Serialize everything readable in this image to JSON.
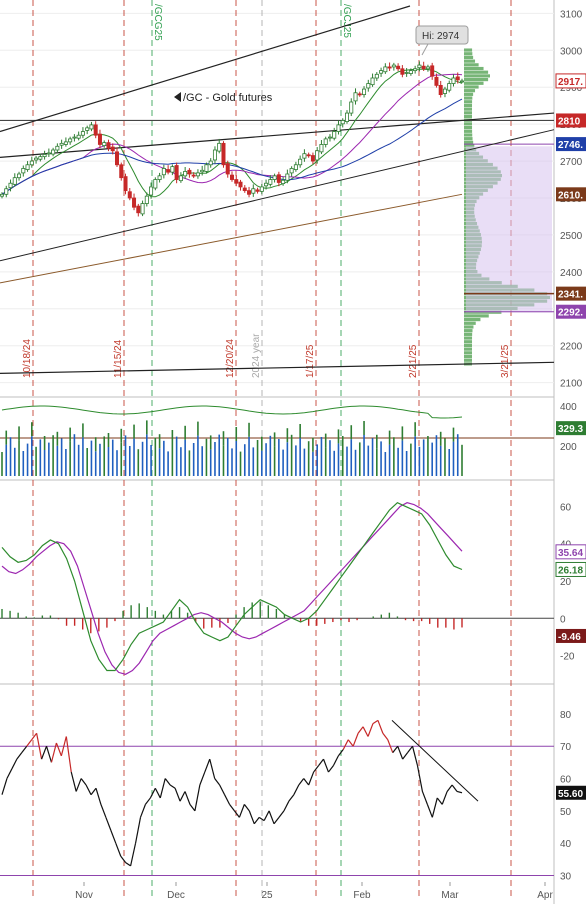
{
  "symbol": {
    "ticker": "/GC",
    "description": "Gold futures",
    "label": "/GC - Gold futures"
  },
  "colors": {
    "up": "#2e7d32",
    "down": "#c62828",
    "price_line": "#333333",
    "ma_green": "#2e8b2e",
    "ma_purple": "#9c27b0",
    "ma_blue": "#1f3fa8",
    "ma_brown": "#8b5a2b",
    "profile_green": "#5fa85f",
    "profile_purple": "#d7c3ee",
    "vline_red": "#c0392b",
    "vline_green": "#2e9e4e",
    "vline_gray": "#aaaaaa",
    "hline_brown": "#7b3a1a",
    "hline_purple": "#8e44ad"
  },
  "x_axis": {
    "labels": [
      "Nov",
      "Dec",
      "25",
      "Feb",
      "Mar",
      "Apr"
    ]
  },
  "chart_data": [
    {
      "type": "candlestick",
      "panel": "price",
      "ylim": [
        2080,
        3120
      ],
      "yticks": [
        2100,
        2200,
        2300,
        2400,
        2500,
        2600,
        2700,
        2800,
        2900,
        3000,
        3100
      ],
      "badges": [
        {
          "value": 2917.1,
          "label": "2917.",
          "color": "#c62828"
        },
        {
          "value": 2810,
          "label": "2810",
          "color": "#c62828"
        },
        {
          "value": 2746,
          "label": "2746.",
          "color": "#1f3fa8"
        },
        {
          "value": 2610,
          "label": "2610.",
          "color": "#7b3a1a"
        },
        {
          "value": 2341,
          "label": "2341.",
          "color": "#7b3a1a"
        },
        {
          "value": 2292,
          "label": "2292.",
          "color": "#8e44ad"
        }
      ],
      "hi_annotation": {
        "label": "Hi: 2974",
        "value": 2974
      },
      "vertical_markers": [
        {
          "label": "10/18/24",
          "color": "red"
        },
        {
          "label": "11/15/24",
          "color": "red"
        },
        {
          "label": "/GCG25",
          "color": "green"
        },
        {
          "label": "12/20/24",
          "color": "red"
        },
        {
          "label": "2024 year",
          "color": "gray"
        },
        {
          "label": "1/17/25",
          "color": "red"
        },
        {
          "label": "/GCJ25",
          "color": "green"
        },
        {
          "label": "2/21/25",
          "color": "red"
        },
        {
          "label": "3/21/25",
          "color": "red"
        }
      ],
      "closes": [
        2610,
        2625,
        2640,
        2655,
        2665,
        2680,
        2690,
        2700,
        2708,
        2712,
        2718,
        2722,
        2730,
        2740,
        2748,
        2752,
        2760,
        2765,
        2770,
        2780,
        2790,
        2798,
        2770,
        2745,
        2750,
        2735,
        2728,
        2690,
        2655,
        2620,
        2600,
        2575,
        2560,
        2585,
        2605,
        2630,
        2650,
        2660,
        2680,
        2670,
        2685,
        2650,
        2660,
        2672,
        2665,
        2660,
        2668,
        2675,
        2690,
        2700,
        2730,
        2748,
        2690,
        2665,
        2650,
        2640,
        2630,
        2620,
        2610,
        2625,
        2618,
        2630,
        2640,
        2650,
        2660,
        2642,
        2648,
        2665,
        2680,
        2690,
        2705,
        2720,
        2715,
        2700,
        2728,
        2745,
        2760,
        2765,
        2780,
        2798,
        2810,
        2830,
        2860,
        2885,
        2880,
        2895,
        2910,
        2925,
        2935,
        2945,
        2955,
        2952,
        2960,
        2950,
        2935,
        2940,
        2945,
        2950,
        2960,
        2950,
        2955,
        2930,
        2905,
        2880,
        2895,
        2910,
        2925,
        2920,
        2917
      ]
    },
    {
      "type": "bar",
      "panel": "volume",
      "yticks": [
        200,
        400
      ],
      "ylim": [
        50,
        430
      ],
      "badge": {
        "value": 329.3,
        "label": "329.3"
      },
      "ref_line": 240
    },
    {
      "type": "line",
      "panel": "oscillator",
      "ylim": [
        -32,
        72
      ],
      "yticks": [
        -20,
        0,
        20,
        40,
        60
      ],
      "series": [
        {
          "values": [
            28,
            25,
            24,
            26,
            29,
            33,
            36,
            39,
            41,
            40,
            36,
            28,
            16,
            4,
            -8,
            -18,
            -25,
            -29,
            -30,
            -28,
            -24,
            -18,
            -12,
            -8,
            -6,
            -4,
            -2,
            0,
            2,
            3,
            2,
            0,
            -2,
            -5,
            -8,
            -10,
            -11,
            -10,
            -8,
            -6,
            -4,
            -2,
            0,
            2,
            4,
            8,
            12,
            16,
            20,
            24,
            28,
            32,
            36,
            40,
            44,
            48,
            52,
            56,
            60,
            62,
            61,
            59,
            56,
            52,
            48,
            44,
            40,
            36
          ]
        },
        {
          "values": [
            38,
            33,
            30,
            31,
            34,
            39,
            42,
            40,
            32,
            20,
            4,
            -12,
            -22,
            -28,
            -28,
            -22,
            -14,
            -8,
            -6,
            -4,
            -2,
            4,
            10,
            6,
            -2,
            -8,
            -10,
            -12,
            -10,
            -4,
            2,
            6,
            10,
            8,
            6,
            2,
            0,
            -2,
            0,
            4,
            10,
            16,
            22,
            28,
            34,
            40,
            46,
            52,
            58,
            62,
            60,
            58,
            56,
            50,
            42,
            34,
            28,
            26.18
          ]
        }
      ],
      "histogram_badge": {
        "value": -9.46,
        "label": "-9.46"
      },
      "badges": [
        {
          "value": 35.64,
          "label": "35.64",
          "color": "#8e44ad"
        },
        {
          "value": 26.18,
          "label": "26.18",
          "color": "#2e7d32"
        }
      ]
    },
    {
      "type": "line",
      "panel": "rsi",
      "ylim": [
        28,
        88
      ],
      "yticks": [
        30,
        40,
        50,
        60,
        70,
        80
      ],
      "levels": [
        70,
        30
      ],
      "badge": {
        "value": 55.6,
        "label": "55.60"
      },
      "series": [
        {
          "values": [
            55,
            60,
            63,
            66,
            68,
            70,
            72,
            74,
            66,
            70,
            65,
            71,
            67,
            73,
            62,
            56,
            60,
            58,
            55,
            57,
            52,
            48,
            44,
            40,
            36,
            34,
            33,
            40,
            48,
            52,
            54,
            57,
            54,
            60,
            58,
            57,
            53,
            56,
            52,
            50,
            58,
            62,
            66,
            60,
            58,
            55,
            52,
            50,
            48,
            52,
            50,
            46,
            48,
            47,
            50,
            46,
            48,
            50,
            53,
            55,
            58,
            60,
            58,
            62,
            64,
            66,
            62,
            64,
            67,
            69,
            72,
            70,
            74,
            76,
            73,
            77,
            78,
            74,
            72,
            68,
            70,
            66,
            68,
            70,
            64,
            56,
            52,
            48,
            54,
            52,
            56,
            58,
            56,
            55.6
          ]
        }
      ]
    }
  ]
}
